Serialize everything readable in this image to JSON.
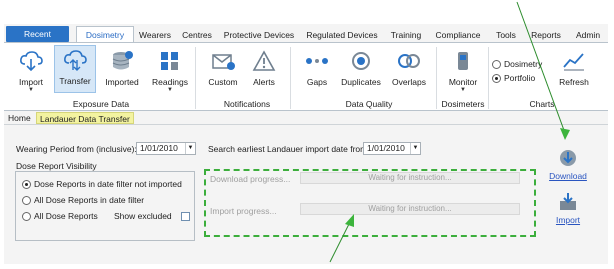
{
  "tabs": [
    "Recent",
    "Dosimetry",
    "Wearers",
    "Centres",
    "Protective Devices",
    "Regulated Devices",
    "Training",
    "Compliance",
    "Tools",
    "Reports",
    "Admin"
  ],
  "active_tab": "Dosimetry",
  "ribbon": {
    "groups": {
      "exposure_data": "Exposure Data",
      "notifications": "Notifications",
      "data_quality": "Data Quality",
      "dosimeters": "Dosimeters",
      "charts": "Charts"
    },
    "buttons": {
      "import": "Import",
      "transfer": "Transfer",
      "imported": "Imported",
      "readings": "Readings",
      "custom": "Custom",
      "alerts": "Alerts",
      "gaps": "Gaps",
      "duplicates": "Duplicates",
      "overlaps": "Overlaps",
      "monitor": "Monitor",
      "refresh": "Refresh"
    },
    "chart_options": {
      "dosimetry": "Dosimetry",
      "portfolio": "Portfolio",
      "selected": "Portfolio"
    }
  },
  "breadcrumb": {
    "home": "Home",
    "current": "Landauer Data Transfer"
  },
  "form": {
    "wearing_period_label": "Wearing Period from (inclusive):",
    "wearing_period_value": "1/01/2010",
    "search_label": "Search earliest Landauer import date from:",
    "search_value": "1/01/2010",
    "visibility_title": "Dose Report Visibility",
    "options": [
      "Dose Reports in date filter not imported",
      "All Dose Reports in date filter",
      "All Dose Reports"
    ],
    "selected_option": "Dose Reports in date filter not imported",
    "show_excluded_label": "Show excluded",
    "show_excluded": false
  },
  "progress": {
    "download_label": "Download progress...",
    "download_status": "Waiting for instruction...",
    "import_label": "Import progress...",
    "import_status": "Waiting for instruction...",
    "download_level": 0,
    "import_level": 0
  },
  "actions": {
    "download": "Download",
    "import": "Import"
  },
  "colors": {
    "accent": "#2a73c6",
    "highlight": "#3cae3c",
    "crumb": "#f3f3a0"
  }
}
